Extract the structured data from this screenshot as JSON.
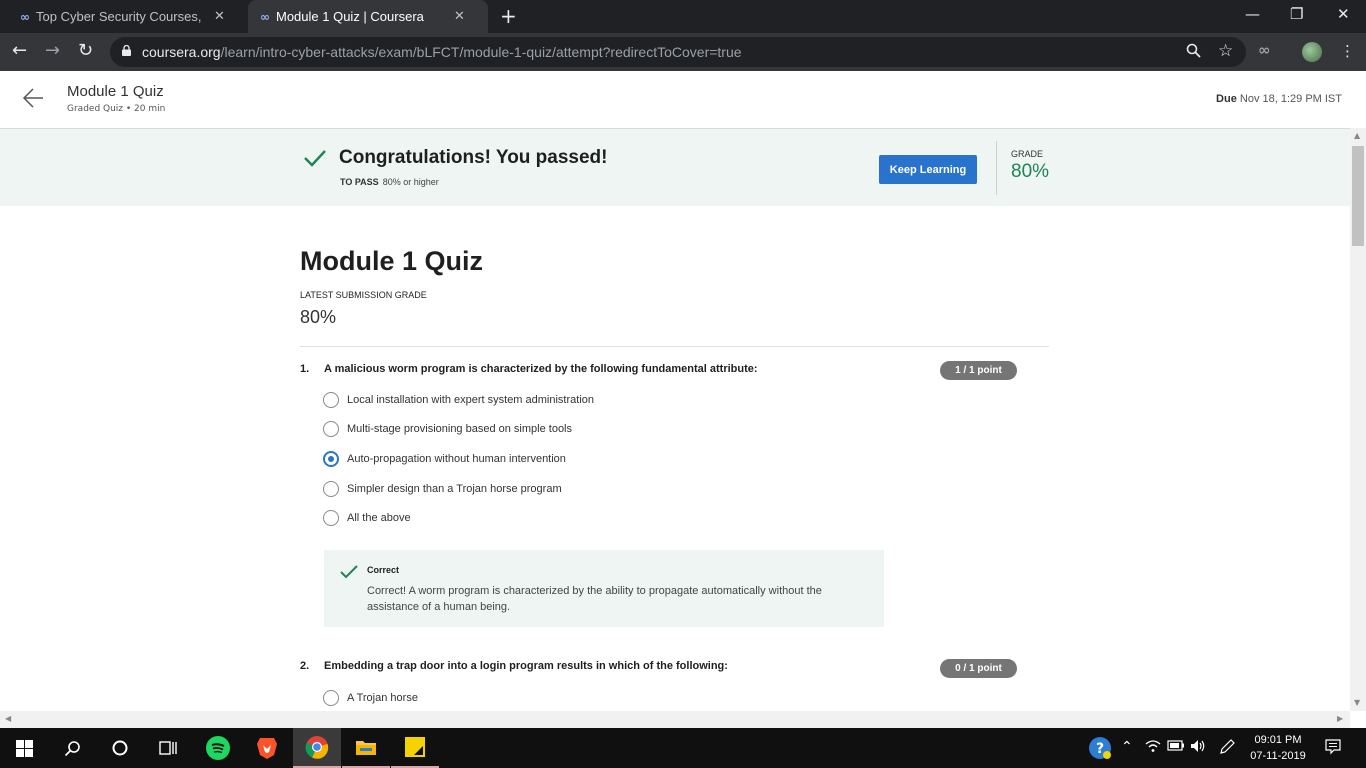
{
  "browser": {
    "tabs": [
      {
        "title": "Top Cyber Security Courses, Nove",
        "close": "✕"
      },
      {
        "title": "Module 1 Quiz | Coursera",
        "close": "✕"
      }
    ],
    "new_tab": "+",
    "url_domain": "coursera.org",
    "url_path": "/learn/intro-cyber-attacks/exam/bLFCT/module-1-quiz/attempt?redirectToCover=true"
  },
  "header": {
    "title": "Module 1 Quiz",
    "subtitle": "Graded Quiz • 20 min",
    "due_label": "Due",
    "due_value": "Nov 18, 1:29 PM IST"
  },
  "banner": {
    "headline": "Congratulations! You passed!",
    "to_pass_label": "TO PASS",
    "to_pass_value": "80% or higher",
    "button": "Keep Learning",
    "grade_label": "GRADE",
    "grade_value": "80%"
  },
  "quiz": {
    "title": "Module 1 Quiz",
    "latest_label": "LATEST SUBMISSION GRADE",
    "latest_value": "80%",
    "questions": [
      {
        "number": "1.",
        "text": "A malicious worm program is characterized by the following fundamental attribute:",
        "points": "1 / 1 point",
        "options": [
          "Local installation with expert system administration",
          "Multi-stage provisioning based on simple tools",
          "Auto-propagation without human intervention",
          "Simpler design than a Trojan horse program",
          "All the above"
        ],
        "selected": 2,
        "feedback_title": "Correct",
        "feedback_text": "Correct! A worm program is characterized by the ability to propagate automatically without the assistance of a human being."
      },
      {
        "number": "2.",
        "text": "Embedding a trap door into a login program results in which of the following:",
        "points": "0 / 1 point",
        "options": [
          "A Trojan horse"
        ]
      }
    ]
  },
  "taskbar": {
    "time": "09:01 PM",
    "date": "07-11-2019"
  }
}
